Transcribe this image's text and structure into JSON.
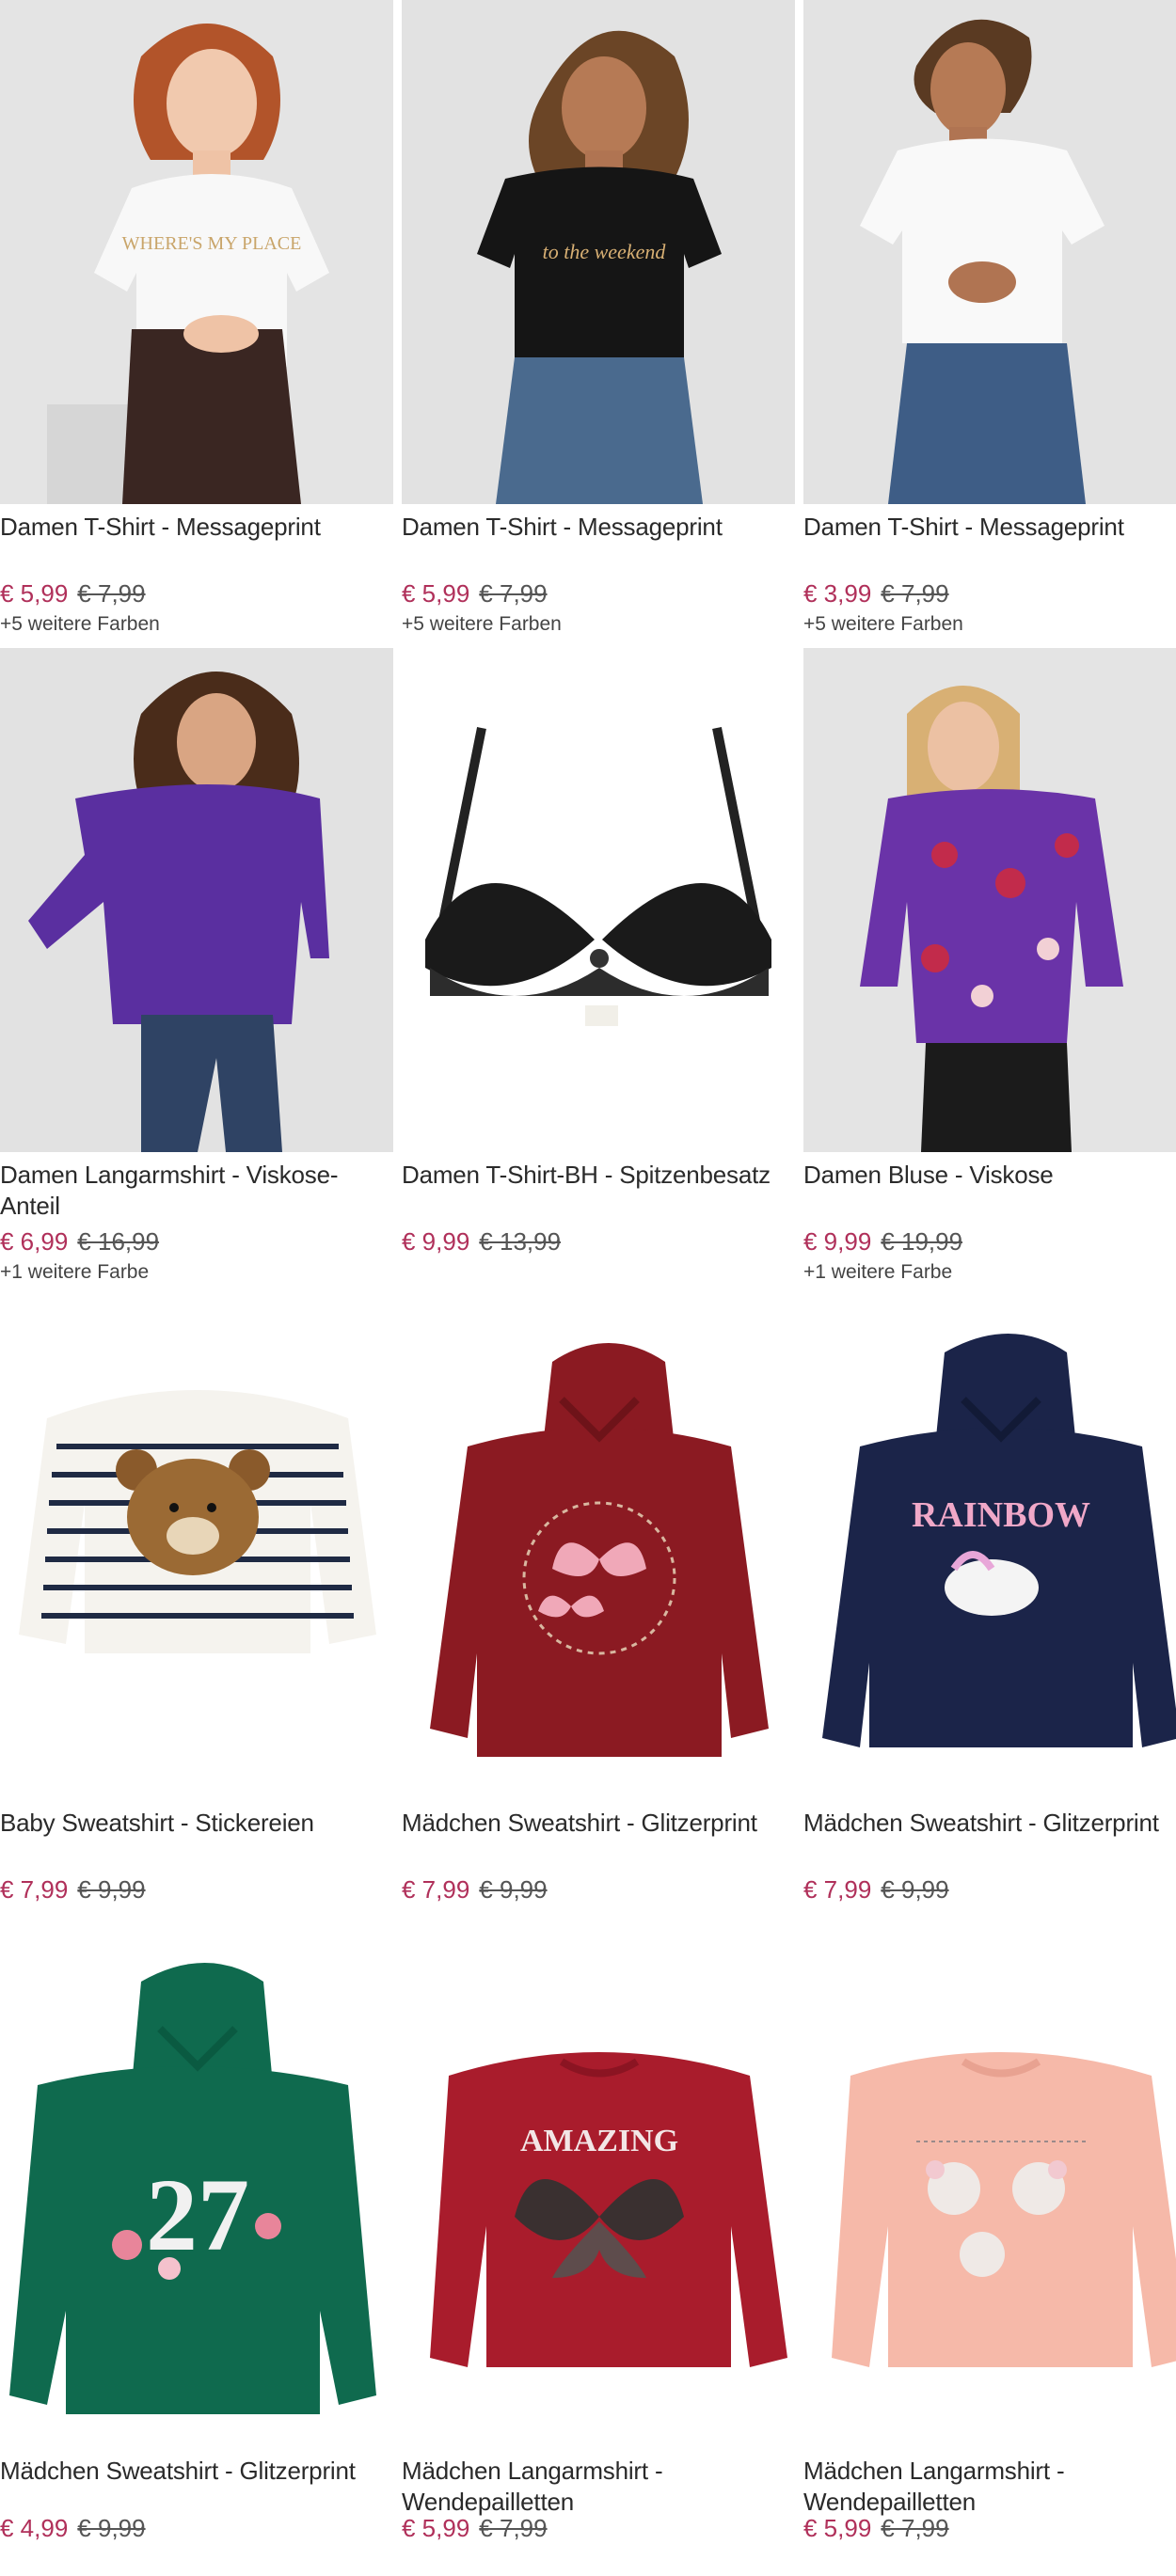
{
  "colors": {
    "price": "#b0305a",
    "old_price": "#555555",
    "text": "#2a2a2a"
  },
  "products": [
    {
      "title": "Damen T-Shirt - Messageprint",
      "price": "€ 5,99",
      "old_price": "€ 7,99",
      "colors_note": "+5 weitere Farben",
      "image": "model-white-tshirt",
      "print": "WHERE'S MY PLACE"
    },
    {
      "title": "Damen T-Shirt - Messageprint",
      "price": "€ 5,99",
      "old_price": "€ 7,99",
      "colors_note": "+5 weitere Farben",
      "image": "model-black-tshirt",
      "print": "to the weekend"
    },
    {
      "title": "Damen T-Shirt - Messageprint",
      "price": "€ 3,99",
      "old_price": "€ 7,99",
      "colors_note": "+5 weitere Farben",
      "image": "model-white-tshirt-2",
      "print": ""
    },
    {
      "title": "Damen Langarmshirt - Viskose-Anteil",
      "price": "€ 6,99",
      "old_price": "€ 16,99",
      "colors_note": "+1 weitere Farbe",
      "image": "model-purple-top"
    },
    {
      "title": "Damen T-Shirt-BH - Spitzenbesatz",
      "price": "€ 9,99",
      "old_price": "€ 13,99",
      "colors_note": "",
      "image": "black-lace-bra"
    },
    {
      "title": "Damen Bluse - Viskose",
      "price": "€ 9,99",
      "old_price": "€ 19,99",
      "colors_note": "+1 weitere Farbe",
      "image": "model-printed-blouse"
    },
    {
      "title": "Baby Sweatshirt - Stickereien",
      "price": "€ 7,99",
      "old_price": "€ 9,99",
      "colors_note": "",
      "image": "striped-bear-sweatshirt"
    },
    {
      "title": "Mädchen Sweatshirt - Glitzerprint",
      "price": "€ 7,99",
      "old_price": "€ 9,99",
      "colors_note": "",
      "image": "red-butterfly-hoodie"
    },
    {
      "title": "Mädchen Sweatshirt - Glitzerprint",
      "price": "€ 7,99",
      "old_price": "€ 9,99",
      "colors_note": "",
      "image": "navy-unicorn-hoodie",
      "print": "RAINBOW"
    },
    {
      "title": "Mädchen Sweatshirt - Glitzerprint",
      "price": "€ 4,99",
      "old_price": "€ 9,99",
      "colors_note": "",
      "image": "green-27-hoodie",
      "print": "27"
    },
    {
      "title": "Mädchen Langarmshirt - Wendepailletten",
      "price": "€ 5,99",
      "old_price": "€ 7,99",
      "colors_note": "",
      "image": "red-butterfly-longsleeve",
      "print": "AMAZING"
    },
    {
      "title": "Mädchen Langarmshirt - Wendepailletten",
      "price": "€ 5,99",
      "old_price": "€ 7,99",
      "colors_note": "",
      "image": "pink-mice-longsleeve"
    }
  ]
}
